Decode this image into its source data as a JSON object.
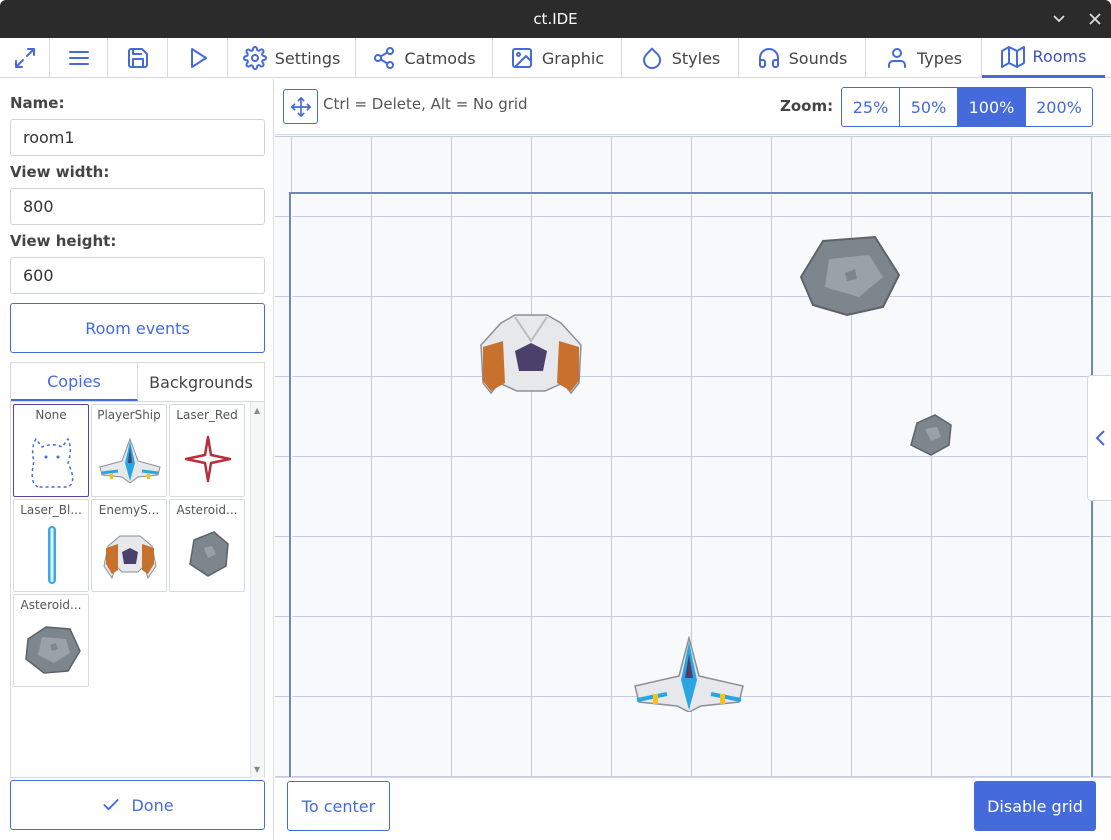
{
  "window": {
    "title": "ct.IDE"
  },
  "topbar": {
    "tabs": [
      {
        "label": "Settings",
        "icon": "gear-icon"
      },
      {
        "label": "Catmods",
        "icon": "share-icon"
      },
      {
        "label": "Graphic",
        "icon": "image-icon"
      },
      {
        "label": "Styles",
        "icon": "droplet-icon"
      },
      {
        "label": "Sounds",
        "icon": "headphones-icon"
      },
      {
        "label": "Types",
        "icon": "user-icon"
      },
      {
        "label": "Rooms",
        "icon": "map-icon"
      }
    ],
    "active_tab": "Rooms"
  },
  "room": {
    "name_label": "Name:",
    "name_value": "room1",
    "width_label": "View width:",
    "width_value": "800",
    "height_label": "View height:",
    "height_value": "600",
    "events_button": "Room events",
    "subtabs": {
      "copies": "Copies",
      "backgrounds": "Backgrounds"
    },
    "copies": [
      "None",
      "PlayerShip",
      "Laser_Red",
      "Laser_Bl...",
      "EnemyS...",
      "Asteroid...",
      "Asteroid..."
    ],
    "done_button": "Done"
  },
  "canvas": {
    "hint": "Ctrl = Delete, Alt = No grid",
    "zoom_label": "Zoom:",
    "zoom_options": [
      "25%",
      "50%",
      "100%",
      "200%"
    ],
    "zoom_selected": "100%",
    "to_center_button": "To center",
    "disable_grid_button": "Disable grid"
  },
  "colors": {
    "accent": "#446adb",
    "titlebar": "#2b2b2b"
  }
}
